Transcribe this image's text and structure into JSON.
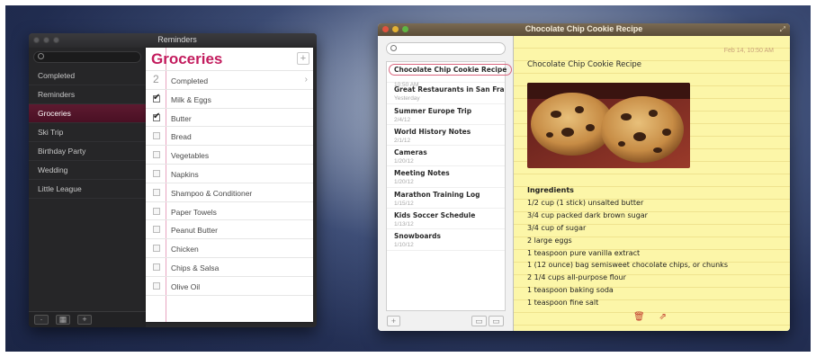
{
  "reminders": {
    "window_title": "Reminders",
    "sidebar_items": [
      {
        "label": "Completed",
        "active": false
      },
      {
        "label": "Reminders",
        "active": false
      },
      {
        "label": "Groceries",
        "active": true
      },
      {
        "label": "Ski Trip",
        "active": false
      },
      {
        "label": "Birthday Party",
        "active": false
      },
      {
        "label": "Wedding",
        "active": false
      },
      {
        "label": "Little League",
        "active": false
      }
    ],
    "list_title": "Groceries",
    "completed_count": "2",
    "completed_label": "Completed",
    "items": [
      {
        "label": "Milk & Eggs",
        "checked": true
      },
      {
        "label": "Butter",
        "checked": true
      },
      {
        "label": "Bread",
        "checked": false
      },
      {
        "label": "Vegetables",
        "checked": false
      },
      {
        "label": "Napkins",
        "checked": false
      },
      {
        "label": "Shampoo & Conditioner",
        "checked": false
      },
      {
        "label": "Paper Towels",
        "checked": false
      },
      {
        "label": "Peanut Butter",
        "checked": false
      },
      {
        "label": "Chicken",
        "checked": false
      },
      {
        "label": "Chips & Salsa",
        "checked": false
      },
      {
        "label": "Olive Oil",
        "checked": false
      }
    ],
    "add_symbol": "+"
  },
  "notes": {
    "window_title": "Chocolate Chip Cookie Recipe",
    "list": [
      {
        "title": "Chocolate Chip Cookie Recipe",
        "date": "10:50 AM",
        "selected": true
      },
      {
        "title": "Great Restaurants in San Fran...",
        "date": "Yesterday",
        "selected": false
      },
      {
        "title": "Summer Europe Trip",
        "date": "2/4/12",
        "selected": false
      },
      {
        "title": "World History Notes",
        "date": "2/1/12",
        "selected": false
      },
      {
        "title": "Cameras",
        "date": "1/20/12",
        "selected": false
      },
      {
        "title": "Meeting Notes",
        "date": "1/20/12",
        "selected": false
      },
      {
        "title": "Marathon Training Log",
        "date": "1/15/12",
        "selected": false
      },
      {
        "title": "Kids Soccer Schedule",
        "date": "1/13/12",
        "selected": false
      },
      {
        "title": "Snowboards",
        "date": "1/10/12",
        "selected": false
      }
    ],
    "add_symbol": "+",
    "note_date": "Feb 14, 10:50 AM",
    "note_title": "Chocolate Chip Cookie Recipe",
    "ingredients_heading": "Ingredients",
    "ingredients": [
      "1/2 cup (1 stick) unsalted butter",
      "3/4 cup packed dark brown sugar",
      "3/4 cup of sugar",
      "2 large eggs",
      "1 teaspoon pure vanilla extract",
      "1 (12 ounce) bag semisweet chocolate chips, or chunks",
      "2 1/4 cups all-purpose flour",
      "1 teaspoon baking soda",
      "1 teaspoon fine salt"
    ]
  },
  "colors": {
    "reminders_accent": "#c31c5e",
    "notes_paper": "#fcf6a8",
    "notes_titlebar": "#5a4c38"
  }
}
